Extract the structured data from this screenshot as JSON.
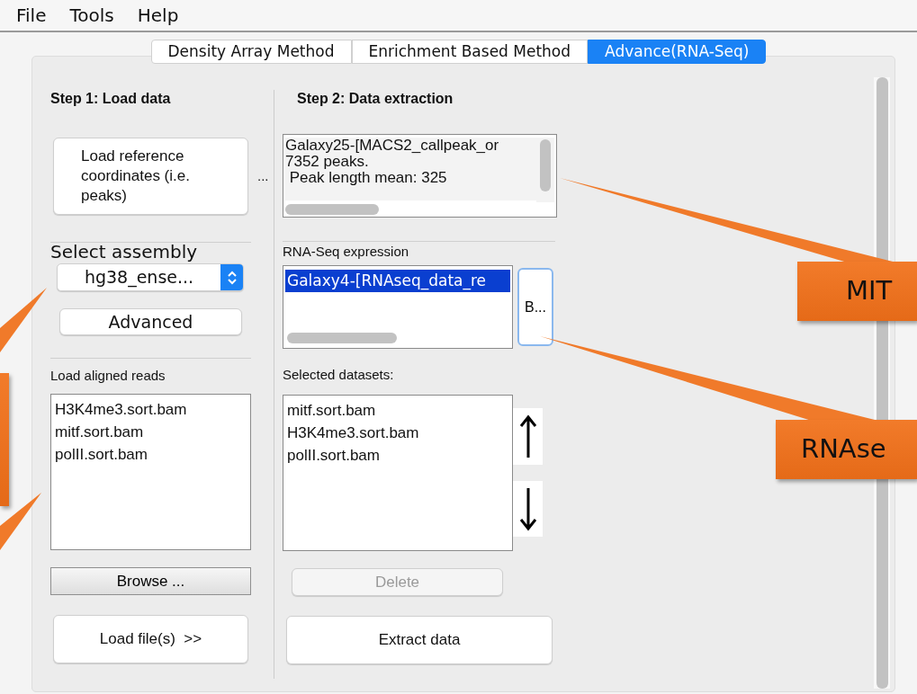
{
  "menu": [
    "File",
    "Tools",
    "Help"
  ],
  "tabs": [
    {
      "label": "Density Array Method",
      "selected": false
    },
    {
      "label": "Enrichment Based Method",
      "selected": false
    },
    {
      "label": "Advance(RNA-Seq)",
      "selected": true
    }
  ],
  "step1": {
    "title": "Step 1: Load data",
    "load_reference_button": "Load reference coordinates (i.e. peaks)",
    "ellipsis": "...",
    "assembly_label": "Select assembly",
    "assembly_value": "hg38_ense...",
    "advanced_button": "Advanced",
    "reads_label": "Load aligned reads",
    "reads": [
      {
        "label": "H3K4me3.sort.bam",
        "selected": false
      },
      {
        "label": "mitf.sort.bam",
        "selected": false
      },
      {
        "label": "polII.sort.bam",
        "selected": false
      }
    ],
    "browse_button": "Browse ...",
    "load_button": "Load file(s)  >>"
  },
  "step2": {
    "title": "Step 2: Data extraction",
    "peaks_info": [
      "Galaxy25-[MACS2_callpeak_or",
      "7352 peaks.",
      " Peak length mean: 325"
    ],
    "rnaseq_label": "RNA-Seq expression",
    "rnaseq_items": [
      {
        "label": "Galaxy4-[RNAseq_data_re",
        "selected": true
      }
    ],
    "rnaseq_browse_button": "B...",
    "selected_label": "Selected datasets:",
    "selected_datasets": [
      {
        "label": "mitf.sort.bam",
        "selected": false
      },
      {
        "label": "H3K4me3.sort.bam",
        "selected": false
      },
      {
        "label": "polII.sort.bam",
        "selected": false
      }
    ],
    "delete_button": {
      "label": "Delete",
      "disabled": true
    },
    "extract_button": "Extract data"
  },
  "callouts": [
    {
      "text": "MIT"
    },
    {
      "text": "RNAse"
    }
  ]
}
